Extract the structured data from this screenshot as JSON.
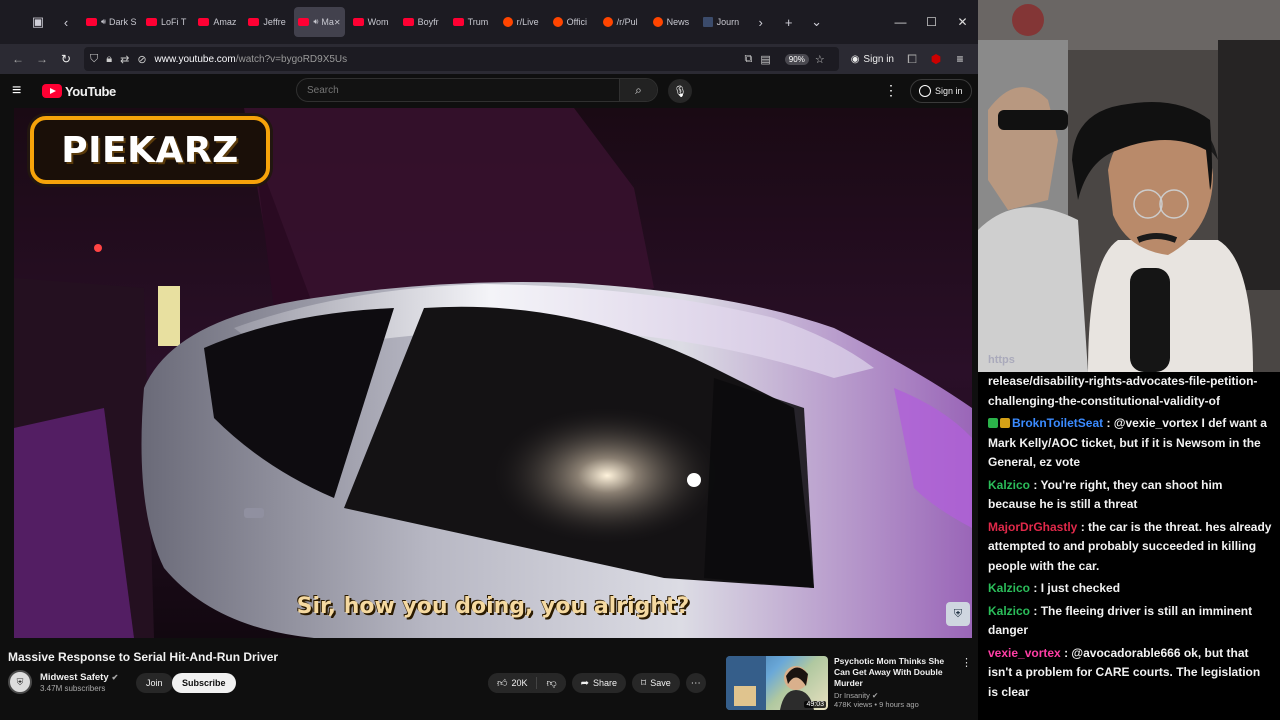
{
  "browser": {
    "tabs": [
      {
        "label": "Dark S",
        "icon": "youtube-favicon",
        "active": false,
        "audio": true
      },
      {
        "label": "LoFi T",
        "icon": "youtube-favicon",
        "active": false,
        "audio": false
      },
      {
        "label": "Amaz",
        "icon": "youtube-favicon",
        "active": false,
        "audio": false
      },
      {
        "label": "Jeffre",
        "icon": "youtube-favicon",
        "active": false,
        "audio": false
      },
      {
        "label": "Ma",
        "icon": "youtube-favicon",
        "active": true,
        "audio": true
      },
      {
        "label": "Wom",
        "icon": "youtube-favicon",
        "active": false,
        "audio": false
      },
      {
        "label": "Boyfr",
        "icon": "youtube-favicon",
        "active": false,
        "audio": false
      },
      {
        "label": "Trum",
        "icon": "youtube-favicon",
        "active": false,
        "audio": false
      },
      {
        "label": "r/Live",
        "icon": "reddit-favicon",
        "active": false,
        "audio": false
      },
      {
        "label": "Offici",
        "icon": "reddit-favicon",
        "active": false,
        "audio": false
      },
      {
        "label": "/r/Pul",
        "icon": "reddit-favicon",
        "active": false,
        "audio": false
      },
      {
        "label": "News",
        "icon": "reddit-favicon",
        "active": false,
        "audio": false
      },
      {
        "label": "Journ",
        "icon": "journal-favicon",
        "active": false,
        "audio": false
      }
    ],
    "url_prefix": "www.youtube.com",
    "url_path": "/watch?v=bygoRD9X5Us",
    "zoom": "90%",
    "sign_in": "Sign in"
  },
  "youtube": {
    "logo_text": "YouTube",
    "search_placeholder": "Search",
    "sign_in": "Sign in"
  },
  "video": {
    "overlay_logo": "PIEKARZ",
    "subtitle": "Sir, how you doing, you alright?",
    "title": "Massive Response to Serial Hit-And-Run Driver",
    "channel": "Midwest Safety",
    "subscribers": "3.47M subscribers",
    "join": "Join",
    "subscribe": "Subscribe",
    "likes": "20K",
    "share": "Share",
    "save": "Save"
  },
  "recommendation": {
    "title": "Psychotic Mom Thinks She Can Get Away With Double Murder",
    "channel": "Dr Insanity",
    "meta": "478K views • 9 hours ago",
    "duration": "49:03"
  },
  "webcam": {
    "url_text": "https"
  },
  "chat": [
    {
      "user": "",
      "user_color": "#ffffff",
      "text": "release/disability-rights-advocates-file-petition-challenging-the-constitutional-validity-of",
      "badges": []
    },
    {
      "user": "BroknToiletSeat",
      "user_color": "#3b8bff",
      "text": ": @vexie_vortex I def want a Mark Kelly/AOC ticket, but if it is Newsom in the General, ez vote",
      "badges": [
        "#2bb34a",
        "#d4a017"
      ]
    },
    {
      "user": "Kalzico",
      "user_color": "#2bbd5a",
      "text": ": You're right, they can shoot him because he is still a threat",
      "badges": []
    },
    {
      "user": "MajorDrGhastly",
      "user_color": "#e0294a",
      "text": ": the car is the threat. hes already attempted to and probably succeeded in killing people with the car.",
      "badges": []
    },
    {
      "user": "Kalzico",
      "user_color": "#2bbd5a",
      "text": ": I just checked",
      "badges": []
    },
    {
      "user": "Kalzico",
      "user_color": "#2bbd5a",
      "text": ": The fleeing driver is still an imminent danger",
      "badges": []
    },
    {
      "user": "vexie_vortex",
      "user_color": "#ff3ea5",
      "text": ": @avocadorable666 ok, but that isn't a problem for CARE courts. The legislation is clear",
      "badges": []
    }
  ]
}
